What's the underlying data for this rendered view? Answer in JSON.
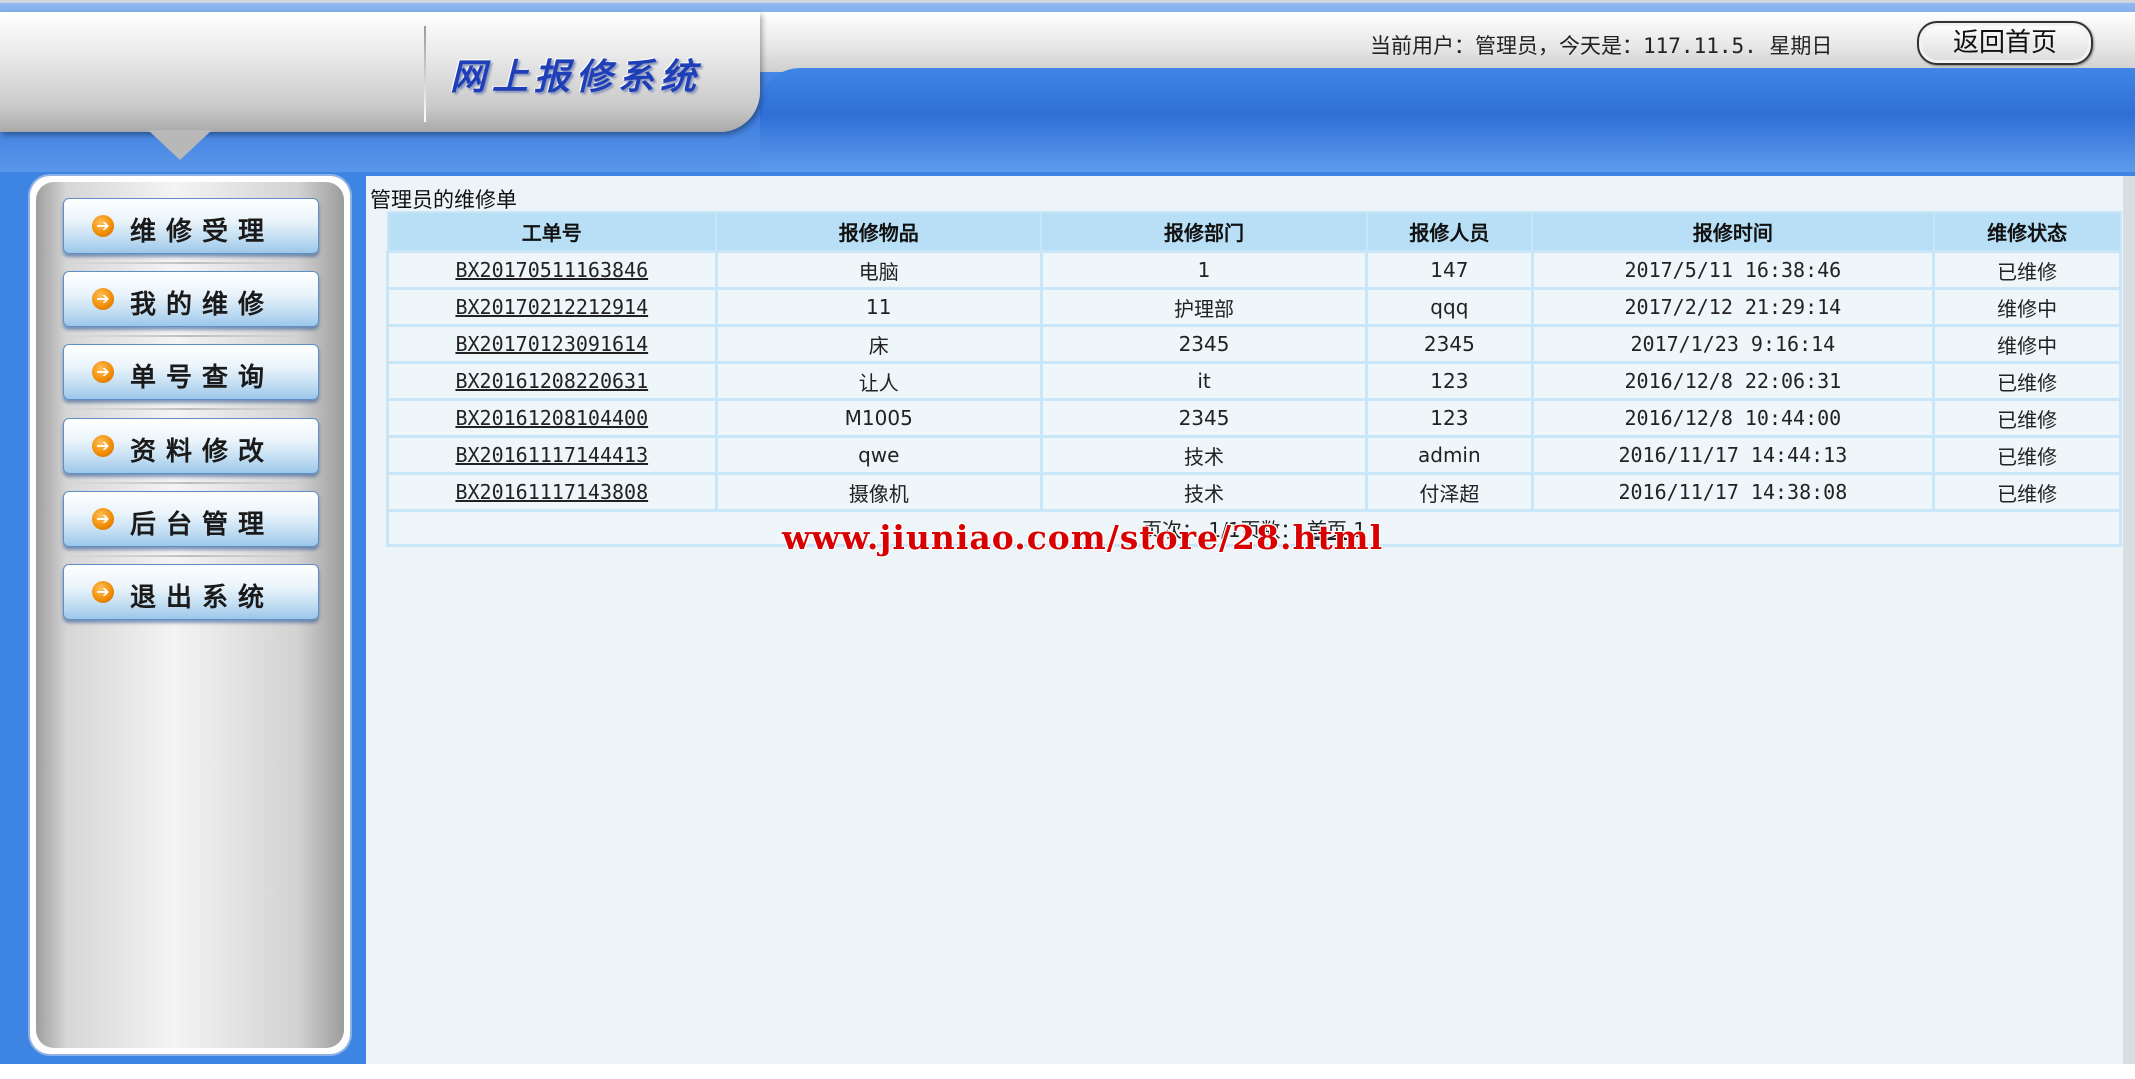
{
  "header": {
    "logo_text": "网上报修系统",
    "user_info": "当前用户：管理员，今天是：117.11.5. 星期日",
    "home_button": "返回首页"
  },
  "sidebar": {
    "items": [
      {
        "label": "维修受理",
        "icon": "arrow-right-circle-icon"
      },
      {
        "label": "我的维修",
        "icon": "arrow-right-circle-icon"
      },
      {
        "label": "单号查询",
        "icon": "arrow-right-circle-icon"
      },
      {
        "label": "资料修改",
        "icon": "arrow-right-circle-icon"
      },
      {
        "label": "后台管理",
        "icon": "arrow-right-circle-icon"
      },
      {
        "label": "退出系统",
        "icon": "arrow-right-circle-icon"
      }
    ]
  },
  "main": {
    "title": "管理员的维修单",
    "columns": [
      "工单号",
      "报修物品",
      "报修部门",
      "报修人员",
      "报修时间",
      "维修状态"
    ],
    "rows": [
      [
        "BX20170511163846",
        "电脑",
        "1",
        "147",
        "2017/5/11 16:38:46",
        "已维修"
      ],
      [
        "BX20170212212914",
        "11",
        "护理部",
        "qqq",
        "2017/2/12 21:29:14",
        "维修中"
      ],
      [
        "BX20170123091614",
        "床",
        "2345",
        "2345",
        "2017/1/23 9:16:14",
        "维修中"
      ],
      [
        "BX20161208220631",
        "让人",
        "it",
        "123",
        "2016/12/8 22:06:31",
        "已维修"
      ],
      [
        "BX20161208104400",
        "M1005",
        "2345",
        "123",
        "2016/12/8 10:44:00",
        "已维修"
      ],
      [
        "BX20161117144413",
        "qwe",
        "技术",
        "admin",
        "2016/11/17 14:44:13",
        "已维修"
      ],
      [
        "BX20161117143808",
        "摄像机",
        "技术",
        "付泽超",
        "2016/11/17 14:38:08",
        "已维修"
      ]
    ],
    "pager": {
      "prefix": "页次： 1/1页数：",
      "first_link": "首页",
      "page_number": "1"
    }
  },
  "watermark": "www.jiuniao.com/store/28.html"
}
